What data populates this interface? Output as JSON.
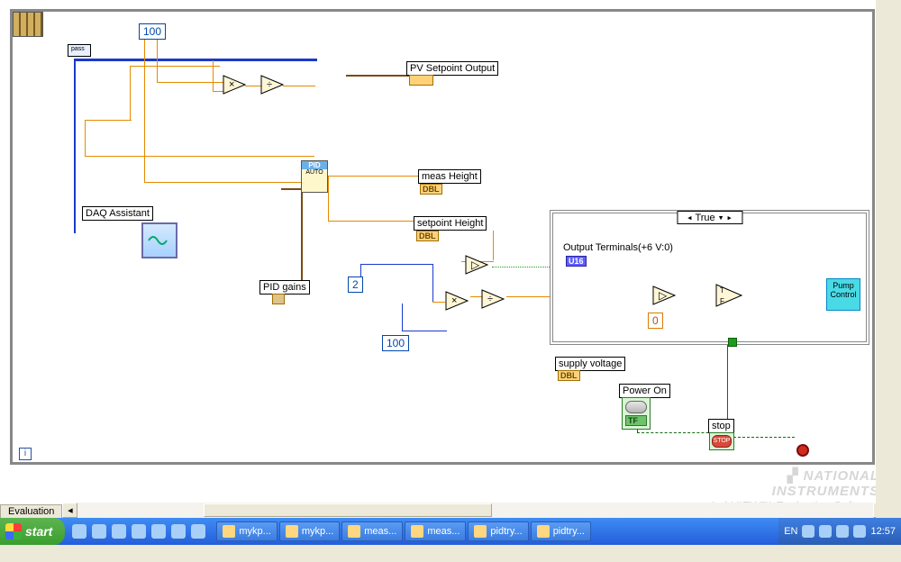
{
  "diagram": {
    "constants": {
      "c100a": "100",
      "c2": "2",
      "c100b": "100",
      "c0": "0"
    },
    "labels": {
      "pv_setpoint": "PV Setpoint Output",
      "daq": "DAQ Assistant",
      "pid_gains": "PID gains",
      "meas_height": "meas Height",
      "setpoint_height": "setpoint Height",
      "output_terminals": "Output Terminals(+6 V:0)",
      "supply_voltage": "supply voltage",
      "power_on": "Power On",
      "stop": "stop",
      "pump": "Pump Control"
    },
    "case_selector": "True",
    "terminals": {
      "dbl": "DBL",
      "tf": "TF",
      "u16": "U16",
      "i": "i",
      "pass": "pass"
    },
    "pid_icon": "PID",
    "pid_icon_sub": "AUTO"
  },
  "bottom": {
    "eval_tab": "Evaluation"
  },
  "watermark": {
    "line1": "NATIONAL",
    "line2": "INSTRUMENTS",
    "line3": "LabVIEW™ Evaluation Software"
  },
  "taskbar": {
    "start": "start",
    "items": [
      "mykp...",
      "mykp...",
      "meas...",
      "meas...",
      "pidtry...",
      "pidtry..."
    ],
    "lang": "EN",
    "clock": "12:57"
  }
}
